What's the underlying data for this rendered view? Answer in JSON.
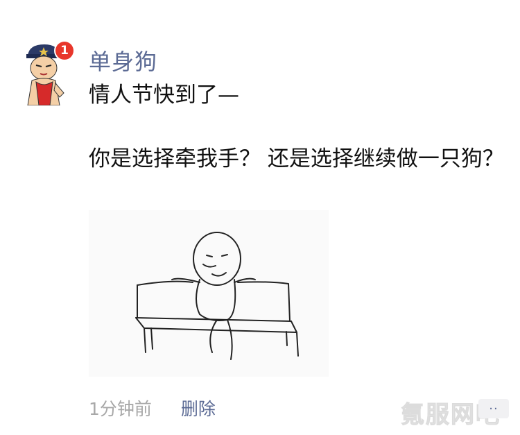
{
  "post": {
    "badge_count": "1",
    "username": "单身狗",
    "text_line_1": "情人节快到了—",
    "text_line_2": "你是选择牵我手？ 还是选择继续做一只狗？",
    "time": "1分钟前",
    "delete_label": "删除",
    "comment_button": "··",
    "watermark": "氪服网吧",
    "colors": {
      "username": "#5b6a94",
      "badge": "#e8362b",
      "time": "#a8a8a8"
    },
    "icons": {
      "avatar": "cartoon-policeman-avatar",
      "image": "meme-sitting-on-bench"
    }
  }
}
